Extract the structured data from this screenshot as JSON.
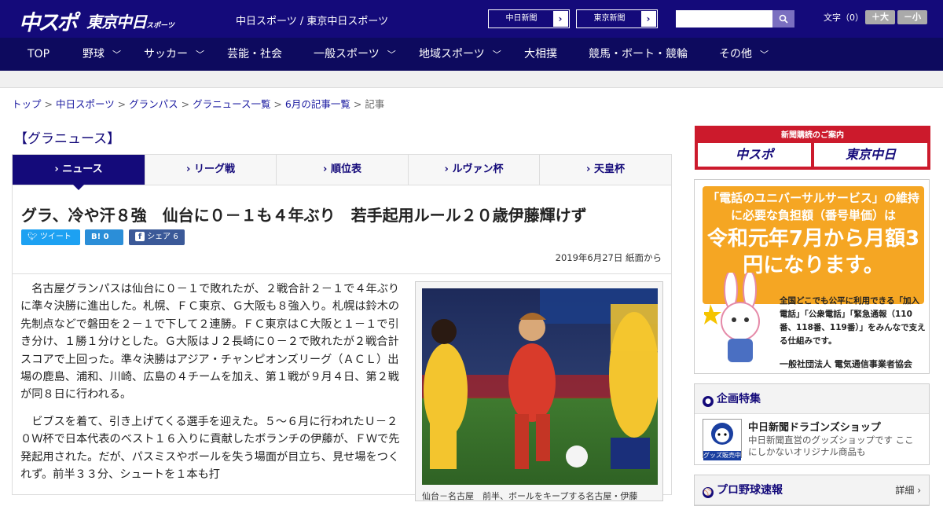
{
  "header": {
    "logo_chunichi_sports": "中スポ",
    "logo_tokyo_chunichi": "東京中日",
    "logo_tokyo_sub": "スポーツ",
    "site_name": "中日スポーツ / 東京中日スポーツ",
    "paper_buttons": [
      "中日新聞",
      "東京新聞"
    ],
    "font_size_label": "文字（0）",
    "font_bigger": "＋大",
    "font_smaller": "－小"
  },
  "nav": {
    "items": [
      {
        "label": "TOP",
        "chevron": false
      },
      {
        "label": "野球",
        "chevron": true
      },
      {
        "label": "サッカー",
        "chevron": true
      },
      {
        "label": "芸能・社会",
        "chevron": false
      },
      {
        "label": "一般スポーツ",
        "chevron": true
      },
      {
        "label": "地域スポーツ",
        "chevron": true
      },
      {
        "label": "大相撲",
        "chevron": false
      },
      {
        "label": "競馬・ボート・競輪",
        "chevron": false
      },
      {
        "label": "その他",
        "chevron": true
      }
    ]
  },
  "breadcrumb": [
    "トップ",
    "中日スポーツ",
    "グランパス",
    "グラニュース一覧",
    "6月の記事一覧",
    "記事"
  ],
  "section_title": "【グラニュース】",
  "tabs": [
    "ニュース",
    "リーグ戦",
    "順位表",
    "ルヴァン杯",
    "天皇杯"
  ],
  "article": {
    "headline": "グラ、冷や汗８強　仙台に０－１も４年ぶり　若手起用ルール２０歳伊藤輝けず",
    "share": {
      "tweet": "ツイート",
      "hatena_count": "0",
      "facebook": "シェア 6"
    },
    "date": "2019年6月27日 紙面から",
    "paragraphs": [
      "名古屋グランパスは仙台に０－１で敗れたが、２戦合計２－１で４年ぶりに準々決勝に進出した。札幌、ＦＣ東京、Ｇ大阪も８強入り。札幌は鈴木の先制点などで磐田を２－１で下して２連勝。ＦＣ東京はＣ大阪と１－１で引き分け、１勝１分けとした。Ｇ大阪はＪ２長崎に０－２で敗れたが２戦合計スコアで上回った。準々決勝はアジア・チャンピオンズリーグ（ＡＣＬ）出場の鹿島、浦和、川崎、広島の４チームを加え、第１戦が９月４日、第２戦が同８日に行われる。",
      "ビブスを着て、引き上げてくる選手を迎えた。５～６月に行われたＵ－２０Ｗ杯で日本代表のベスト１６入りに貢献したボランチの伊藤が、ＦＷで先発起用された。だが、パスミスやボールを失う場面が目立ち、見せ場をつくれず。前半３３分、シュートを１本も打"
    ],
    "photo_caption": "仙台－名古屋　前半、ボールをキープする名古屋・伊藤"
  },
  "sidebar": {
    "subscribe_title": "新聞購読のご案内",
    "subscribe_papers": [
      "中スポ",
      "東京中日"
    ],
    "ad": {
      "lead": "「電話のユニバーサルサービス」の維持に必要な負担額（番号単価）は",
      "headline": "令和元年7月から月額3円になります。",
      "body": "全国どこでも公平に利用できる「加入電話」「公衆電話」「緊急通報（110番、118番、119番）」をみんなで支える仕組みです。",
      "org": "一般社団法人 電気通信事業者協会"
    },
    "feature_title": "企画特集",
    "feature_item_title": "中日新聞ドラゴンズショップ",
    "feature_item_desc": "中日新聞直営のグッズショップです ここにしかないオリジナル商品も",
    "feature_badge": "グッズ販売中",
    "pro_title": "プロ野球速報",
    "pro_more": "詳細 ›"
  },
  "colors": {
    "brand": "#140a7a",
    "nav": "#0d0a5e",
    "accent_red": "#cc1a2c",
    "ad_orange": "#f5a623"
  }
}
